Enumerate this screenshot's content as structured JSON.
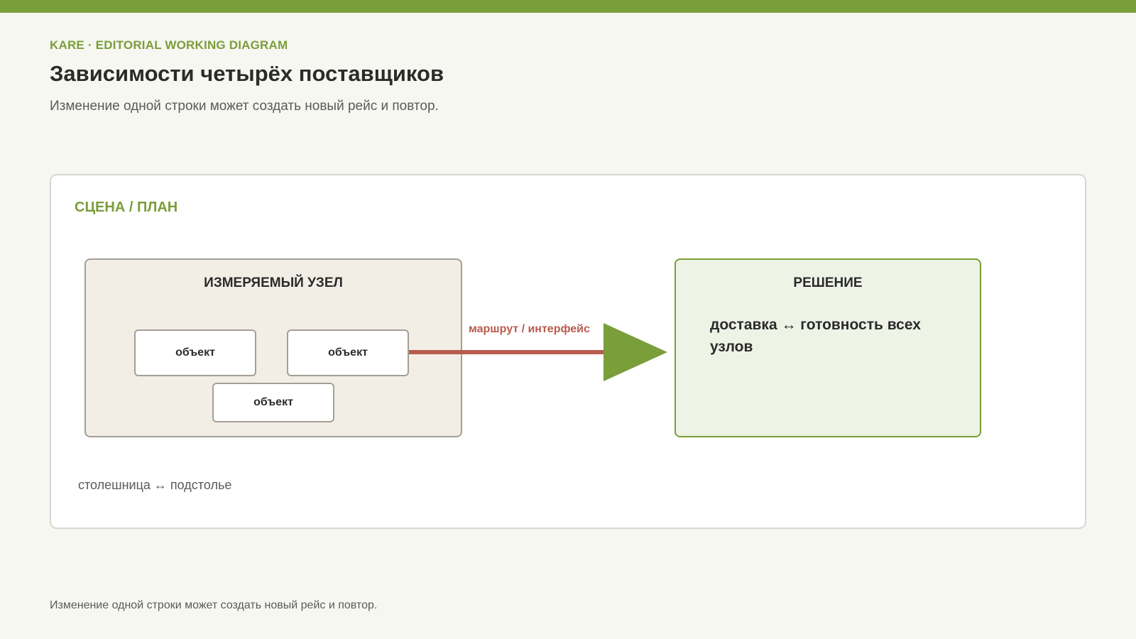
{
  "header": {
    "eyebrow": "KARE · EDITORIAL WORKING DIAGRAM",
    "title": "Зависимости четырёх поставщиков",
    "subtitle": "Изменение одной строки может создать новый рейс и повтор."
  },
  "card": {
    "label": "СЦЕНА / ПЛАН",
    "node": {
      "title": "ИЗМЕРЯЕМЫЙ УЗЕЛ",
      "objects": [
        "объект",
        "объект",
        "объект"
      ]
    },
    "edge": {
      "label": "маршрут / интерфейс"
    },
    "decision": {
      "title": "РЕШЕНИЕ",
      "body": "доставка ↔ готовность всех узлов"
    },
    "caption": "столешница ↔ подстолье"
  },
  "footer": {
    "note": "Изменение одной строки может создать новый рейс и повтор."
  },
  "colors": {
    "accent": "#7a9e3a",
    "edge": "#b85c4e",
    "node_fill": "#f2eee6",
    "decision_fill": "#eef3e6"
  }
}
